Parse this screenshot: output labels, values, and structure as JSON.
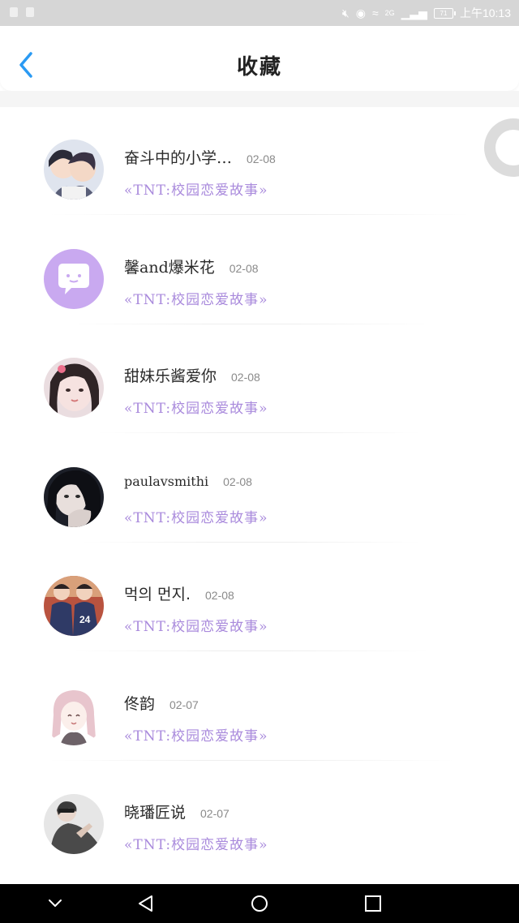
{
  "status_bar": {
    "time": "上午10:13",
    "network": "2G",
    "battery": "71"
  },
  "header": {
    "title": "收藏",
    "back_icon": "chevron-left-icon"
  },
  "colors": {
    "accent_blue": "#2a9af3",
    "story_purple": "#a98adc",
    "avatar_purple": "#c9a9f0"
  },
  "favorites": [
    {
      "name": "奋斗中的小学…",
      "date": "02-08",
      "story": "«TNT:校园恋爱故事»",
      "avatar": "anime-boys"
    },
    {
      "name": "馨and爆米花",
      "date": "02-08",
      "story": "«TNT:校园恋爱故事»",
      "avatar": "default-chat-bubble"
    },
    {
      "name": "甜妹乐酱爱你",
      "date": "02-08",
      "story": "«TNT:校园恋爱故事»",
      "avatar": "girl-photo"
    },
    {
      "name": "paulavsmithi",
      "date": "02-08",
      "story": "«TNT:校园恋爱故事»",
      "avatar": "dark-hair-photo"
    },
    {
      "name": "먹의 먼지.",
      "date": "02-08",
      "story": "«TNT:校园恋爱故事»",
      "avatar": "basketball-photo"
    },
    {
      "name": "佟韵",
      "date": "02-07",
      "story": "«TNT:校园恋爱故事»",
      "avatar": "anime-girl"
    },
    {
      "name": "晓璠匠说",
      "date": "02-07",
      "story": "«TNT:校园恋爱故事»",
      "avatar": "grey-person-photo"
    }
  ],
  "nav": {
    "down": "chevron-down-icon",
    "back": "triangle-back-icon",
    "home": "circle-home-icon",
    "recent": "square-recent-icon"
  }
}
